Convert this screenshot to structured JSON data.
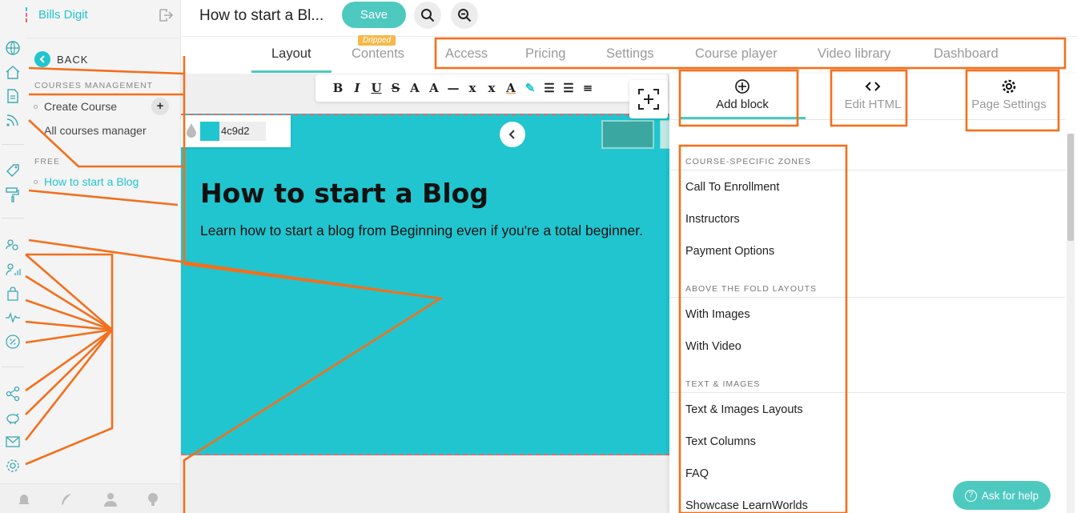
{
  "brand": {
    "name": "Bills Digit",
    "colors": [
      "#f35b4f",
      "#f6b84a",
      "#21c5cf",
      "#8ac34a",
      "#4a90e2",
      "#e85bb0",
      "#6c5fd3",
      "#21c5cf",
      "#f35b4f"
    ]
  },
  "header": {
    "course_title": "How to start a Bl...",
    "save_label": "Save"
  },
  "sidebar": {
    "back_label": "BACK",
    "sections": [
      {
        "title": "COURSES MANAGEMENT",
        "items": [
          {
            "label": "Create Course"
          },
          {
            "label": "All courses manager"
          }
        ]
      },
      {
        "title": "FREE",
        "items": [
          {
            "label": "How to start a Blog"
          }
        ]
      }
    ]
  },
  "tabs": [
    {
      "label": "Layout"
    },
    {
      "label": "Contents",
      "badge": "Dripped"
    },
    {
      "label": "Access"
    },
    {
      "label": "Pricing"
    },
    {
      "label": "Settings"
    },
    {
      "label": "Course player"
    },
    {
      "label": "Video library"
    },
    {
      "label": "Dashboard"
    }
  ],
  "editor": {
    "toolbar": [
      "B",
      "I",
      "U",
      "S",
      "A",
      "A",
      "—",
      "x",
      "x",
      "A",
      "✎",
      "☰",
      "☰",
      "≡"
    ],
    "color_hex": "4c9d2",
    "hero_title": "How to start a Blog",
    "hero_subtitle": "Learn how to start a blog from Beginning even if you're a total beginner."
  },
  "panel": {
    "tabs": [
      {
        "label": "Add block",
        "icon": "plus-circle-icon"
      },
      {
        "label": "Edit HTML",
        "icon": "code-icon"
      },
      {
        "label": "Page Settings",
        "icon": "gear-icon"
      }
    ],
    "groups": [
      {
        "title": "COURSE-SPECIFIC ZONES",
        "items": [
          "Call To Enrollment",
          "Instructors",
          "Payment Options"
        ]
      },
      {
        "title": "ABOVE THE FOLD LAYOUTS",
        "items": [
          "With Images",
          "With Video"
        ]
      },
      {
        "title": "TEXT & IMAGES",
        "items": [
          "Text & Images Layouts",
          "Text Columns",
          "FAQ",
          "Showcase LearnWorlds"
        ]
      }
    ],
    "help_label": "Ask for help"
  },
  "colors": {
    "accent": "#4ec9c0",
    "hero": "#21c5cf",
    "annotation": "#f36f1c"
  }
}
